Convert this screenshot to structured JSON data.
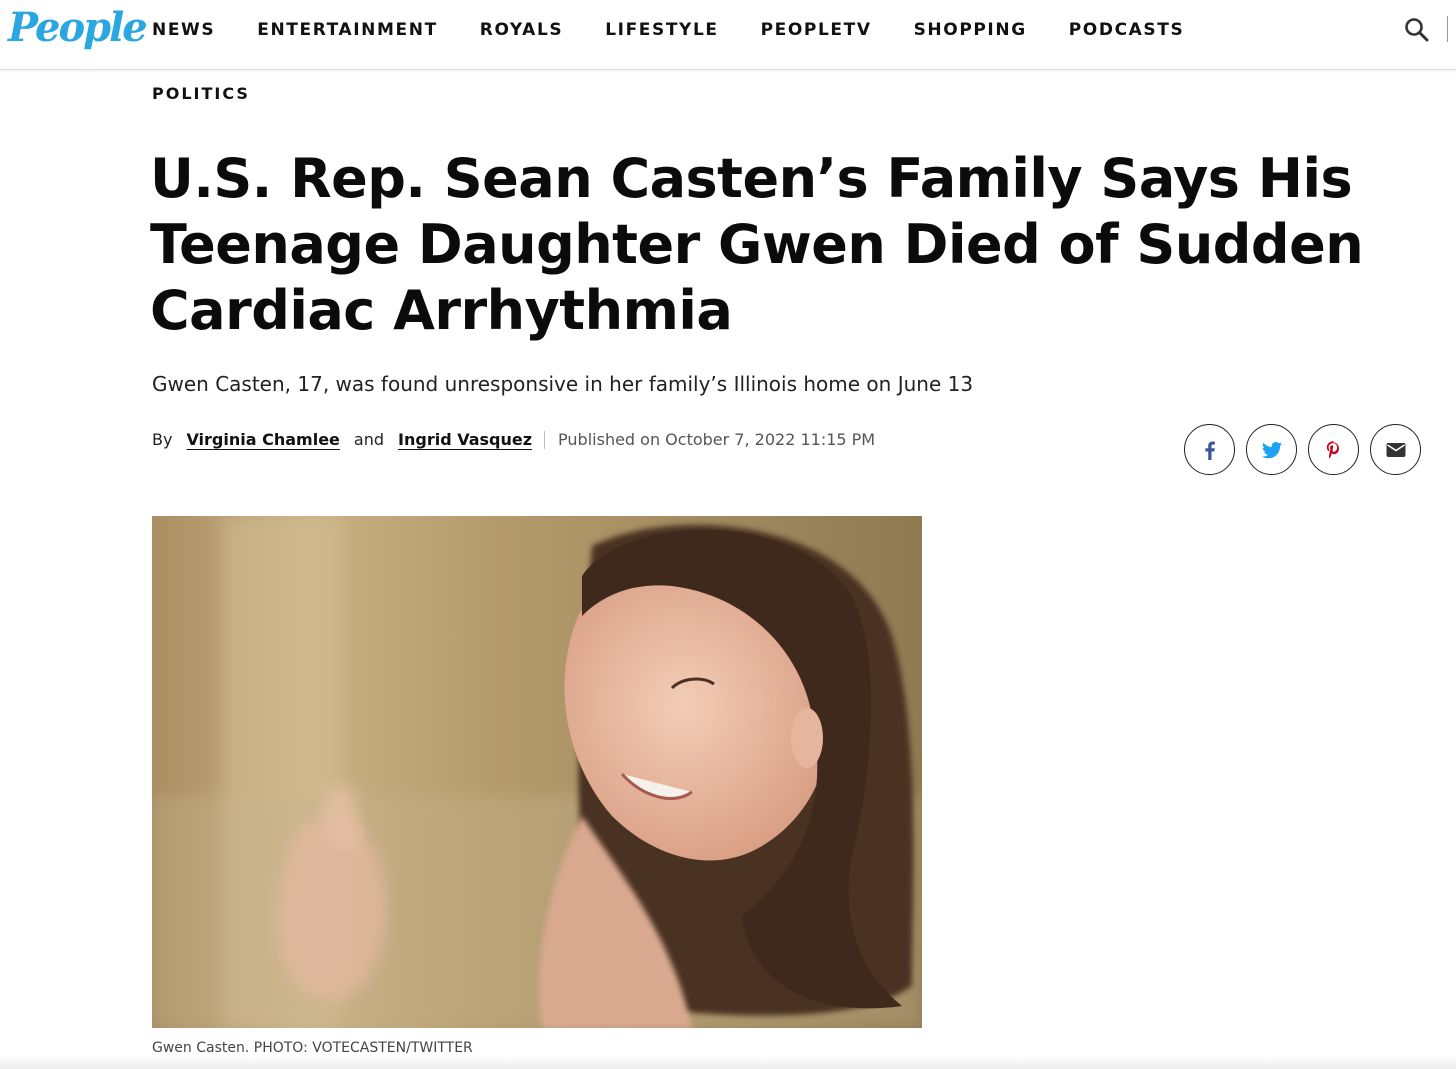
{
  "brand": {
    "logo_text": "People",
    "accent": "#2aa6e0"
  },
  "nav": {
    "items": [
      "NEWS",
      "ENTERTAINMENT",
      "ROYALS",
      "LIFESTYLE",
      "PEOPLETV",
      "SHOPPING",
      "PODCASTS"
    ],
    "search_icon": "search-icon"
  },
  "article": {
    "category": "POLITICS",
    "headline_lines": [
      "U.S. Rep. Sean Casten’s Family Says His",
      "Teenage Daughter Gwen Died of Sudden",
      "Cardiac Arrhythmia"
    ],
    "dek": "Gwen Casten, 17, was found unresponsive in her family’s Illinois home on June 13",
    "byline": {
      "prefix": "By",
      "author1": "Virginia Chamlee",
      "joiner": "and",
      "author2": "Ingrid Vasquez",
      "published": "Published on October 7, 2022 11:15 PM"
    },
    "share": [
      {
        "icon": "facebook-icon",
        "color": "#3b5998"
      },
      {
        "icon": "twitter-icon",
        "color": "#1da1f2"
      },
      {
        "icon": "pinterest-icon",
        "color": "#bd081c"
      },
      {
        "icon": "email-icon",
        "color": "#333333"
      }
    ],
    "photo_caption": "Gwen Casten. PHOTO: VOTECASTEN/TWITTER"
  }
}
